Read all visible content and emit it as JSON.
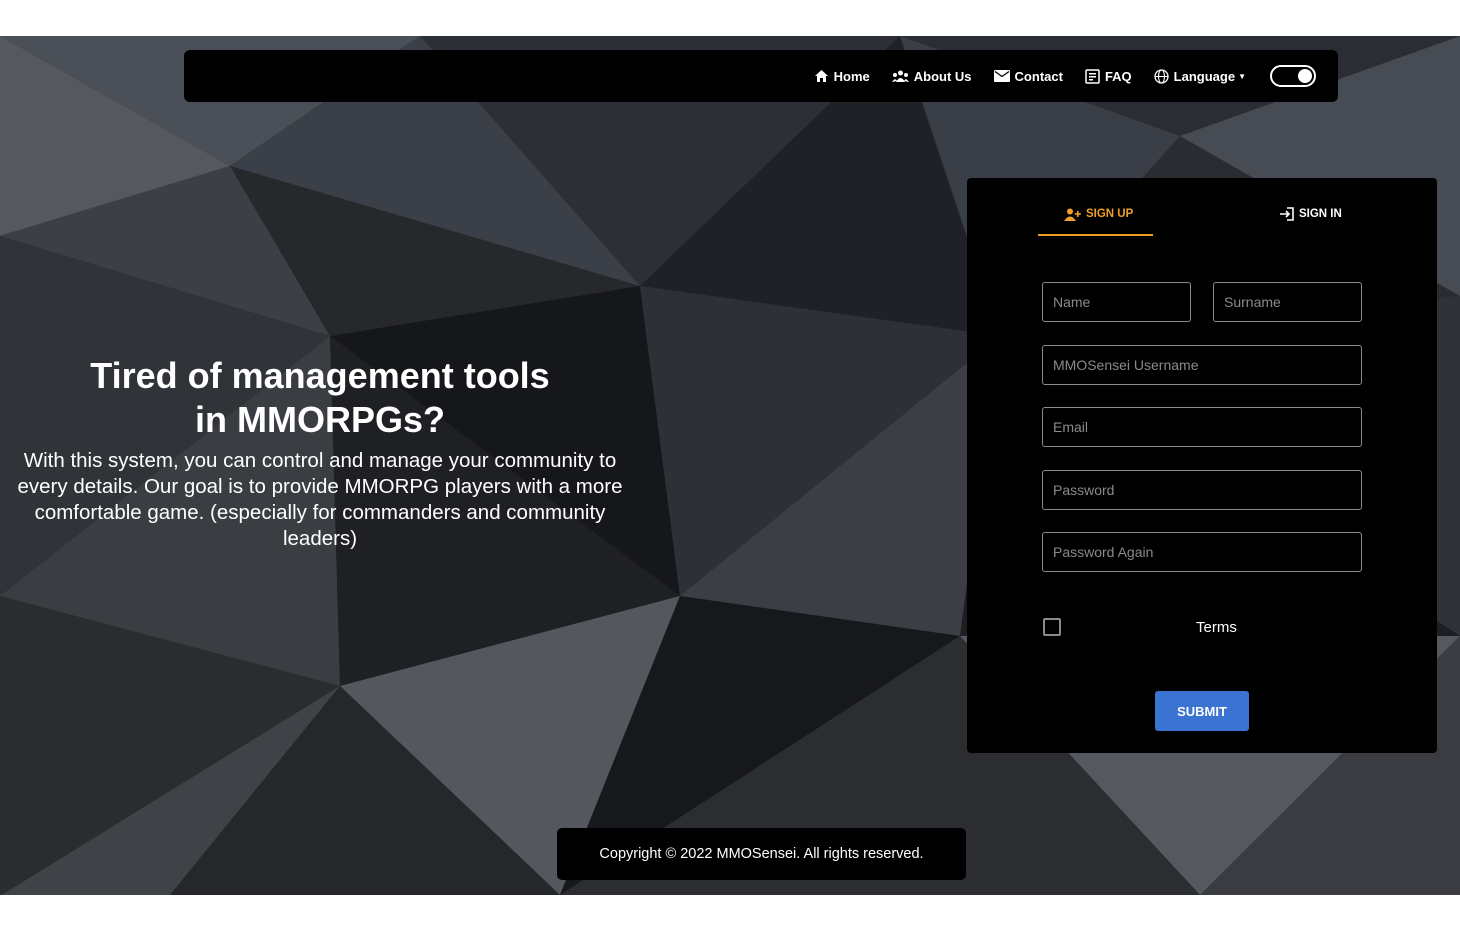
{
  "nav": {
    "items": [
      {
        "label": "Home",
        "icon": "home-icon"
      },
      {
        "label": "About Us",
        "icon": "people-icon"
      },
      {
        "label": "Contact",
        "icon": "mail-icon"
      },
      {
        "label": "FAQ",
        "icon": "book-icon"
      },
      {
        "label": "Language",
        "icon": "globe-icon"
      }
    ],
    "theme_toggle_icon": "dark-mode-toggle"
  },
  "hero": {
    "title": "Tired of management tools in MMORPGs?",
    "description": "With this system, you can control and manage your community to every details. Our goal is to provide MMORPG players with a more comfortable game. (especially for commanders and community leaders)"
  },
  "auth": {
    "tabs": {
      "signup": "SIGN UP",
      "signin": "SIGN IN"
    },
    "fields": {
      "name": "Name",
      "surname": "Surname",
      "username": "MMOSensei Username",
      "email": "Email",
      "password": "Password",
      "password_again": "Password Again"
    },
    "terms_label": "Terms",
    "submit_label": "SUBMIT"
  },
  "footer": {
    "copyright": "Copyright © 2022 MMOSensei. All rights reserved."
  },
  "colors": {
    "accent": "#f0a02a",
    "submit": "#3a73d2",
    "panel": "#000000"
  }
}
